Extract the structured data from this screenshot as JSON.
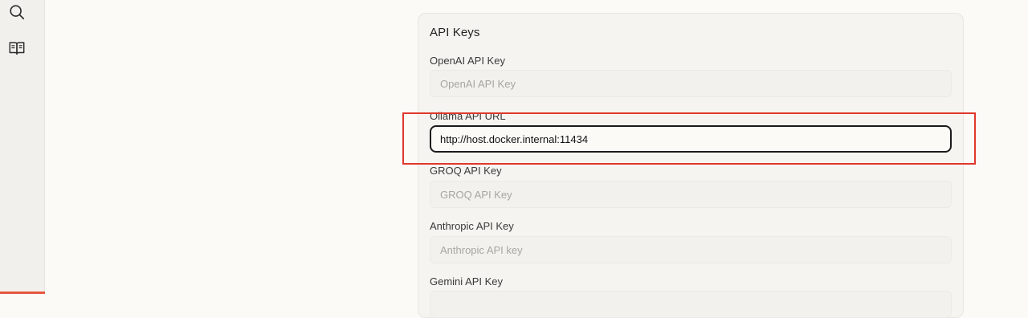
{
  "sidebar": {
    "icons": [
      {
        "name": "search-icon"
      },
      {
        "name": "book-icon"
      }
    ],
    "accent_color": "#e4573e"
  },
  "api_keys": {
    "title": "API Keys",
    "fields": [
      {
        "label": "OpenAI API Key",
        "placeholder": "OpenAI API Key",
        "value": ""
      },
      {
        "label": "Ollama API URL",
        "placeholder": "",
        "value": "http://host.docker.internal:11434"
      },
      {
        "label": "GROQ API Key",
        "placeholder": "GROQ API Key",
        "value": ""
      },
      {
        "label": "Anthropic API Key",
        "placeholder": "Anthropic API key",
        "value": ""
      },
      {
        "label": "Gemini API Key",
        "placeholder": "",
        "value": ""
      }
    ]
  },
  "annotation": {
    "highlight_color": "#e0372c"
  }
}
